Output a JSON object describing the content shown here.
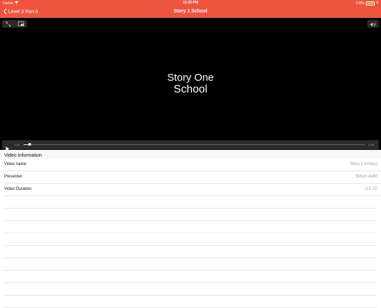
{
  "status_bar": {
    "carrier": "Carrier",
    "time": "12:23 PM",
    "battery": "100%",
    "battery_level": 1.0,
    "icons": [
      "wifi-icon",
      "battery-icon",
      "charging-icon"
    ]
  },
  "nav": {
    "back_label": "Level 3 Part A",
    "title": "Story 1 School",
    "color": "#ef5441"
  },
  "video": {
    "title_line1": "Story One",
    "title_line2": "School",
    "elapsed": "0:08",
    "remaining": "-5:08",
    "progress_fraction": 0.018,
    "icons": [
      "fullscreen-icon",
      "picture-in-picture-icon",
      "volume-icon",
      "play-icon"
    ]
  },
  "info": {
    "header": "Video Information",
    "rows": [
      {
        "label": "Video name",
        "value": "Story 1 School"
      },
      {
        "label": "Presenter",
        "value": "Simon Astill"
      },
      {
        "label": "Video Duration",
        "value": "0:5:13"
      }
    ]
  }
}
